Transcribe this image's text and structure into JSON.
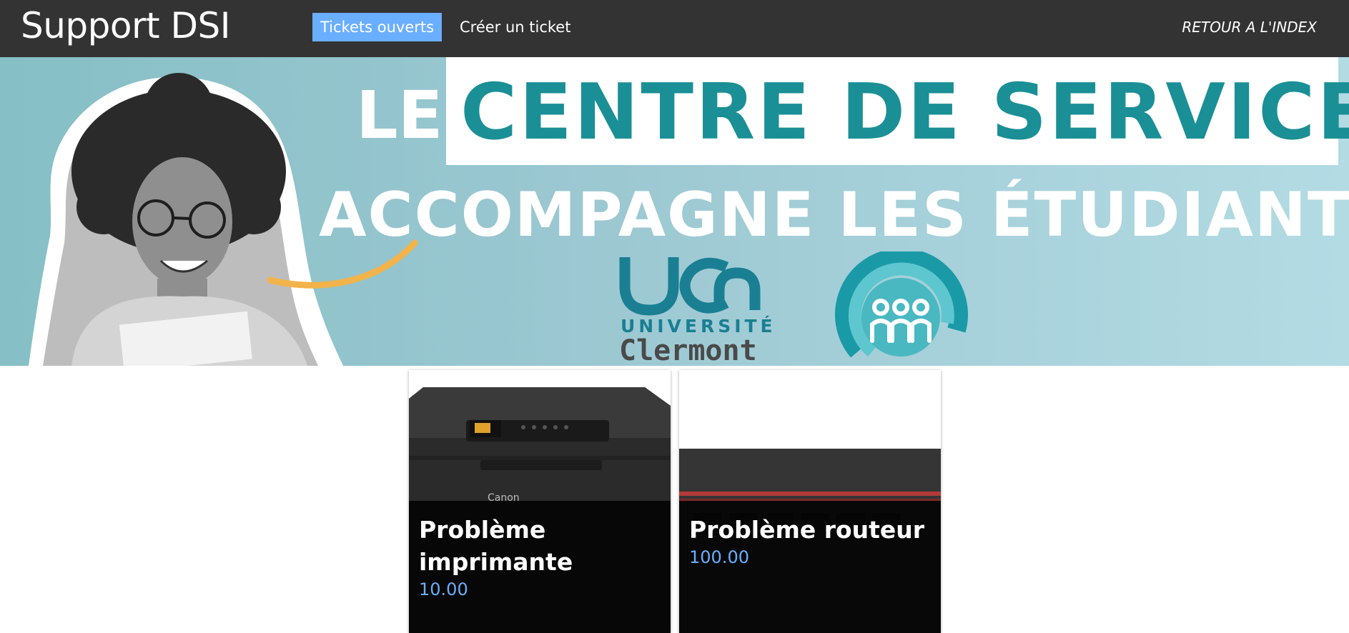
{
  "navbar": {
    "brand": "Support DSI",
    "links": [
      {
        "label": "Tickets ouverts",
        "active": true
      },
      {
        "label": "Créer un ticket",
        "active": false
      }
    ],
    "back_link": "RETOUR A L'INDEX"
  },
  "banner": {
    "headline_le": "LE",
    "headline_highlight": "CENTRE DE SERVICE",
    "headline_line2": "ACCOMPAGNE LES ÉTUDIANTS",
    "logo_university": "UNIVERSITÉ",
    "logo_city": "Clermont"
  },
  "cards": [
    {
      "title": "Problème imprimante",
      "price": "10.00",
      "image": "printer-image"
    },
    {
      "title": "Problème routeur",
      "price": "100.00",
      "image": "router-image"
    }
  ],
  "colors": {
    "navbar_bg": "#333333",
    "active_link": "#6aaeff",
    "brand_teal": "#1a8f96",
    "price_blue": "#6aaeff"
  }
}
